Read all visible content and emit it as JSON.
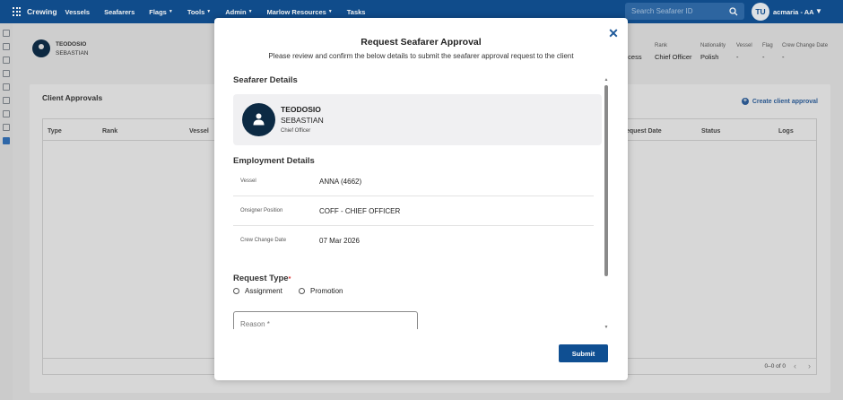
{
  "topbar": {
    "brand": "Crewing",
    "nav": [
      {
        "label": "Vessels",
        "caret": false
      },
      {
        "label": "Seafarers",
        "caret": false
      },
      {
        "label": "Flags",
        "caret": true
      },
      {
        "label": "Tools",
        "caret": true
      },
      {
        "label": "Admin",
        "caret": true
      },
      {
        "label": "Marlow Resources",
        "caret": true
      },
      {
        "label": "Tasks",
        "caret": false
      }
    ],
    "search_placeholder": "Search Seafarer ID",
    "avatar_initials": "TU",
    "user_name": "acmaria - AA",
    "user_caret": "▼"
  },
  "background": {
    "seafarer_first": "TEODOSIO",
    "seafarer_last": "SEBASTIAN",
    "header_columns": [
      "Rank",
      "Nationality",
      "Vessel",
      "Flag",
      "Crew Change Date"
    ],
    "header_values": [
      "Chief Officer",
      "Polish",
      "-",
      "-",
      "-"
    ],
    "partial_value": "ocess",
    "card_title": "Client Approvals",
    "create_label": "Create client approval",
    "table_headers": [
      "Type",
      "Rank",
      "Vessel",
      "equest Date",
      "Status",
      "Logs"
    ],
    "pager": "0–0 of 0"
  },
  "modal": {
    "title": "Request Seafarer Approval",
    "subtitle": "Please review and confirm the below details to submit the seafarer approval request to the client",
    "close": "✕",
    "seafarer_section": "Seafarer Details",
    "seafarer": {
      "first": "TEODOSIO",
      "last": "SEBASTIAN",
      "rank": "Chief Officer"
    },
    "employment_section": "Employment Details",
    "employment": [
      {
        "label": "Vessel",
        "value": "ANNA (4662)"
      },
      {
        "label": "Onsigner Position",
        "value": "COFF - CHIEF OFFICER"
      },
      {
        "label": "Crew Change Date",
        "value": "07 Mar 2026"
      }
    ],
    "request_type_label": "Request Type",
    "required_mark": "*",
    "request_options": [
      "Assignment",
      "Promotion"
    ],
    "reason_placeholder": "Reason *",
    "submit": "Submit"
  },
  "colors": {
    "primary": "#0f4f92",
    "dark_avatar": "#0c2a44"
  }
}
